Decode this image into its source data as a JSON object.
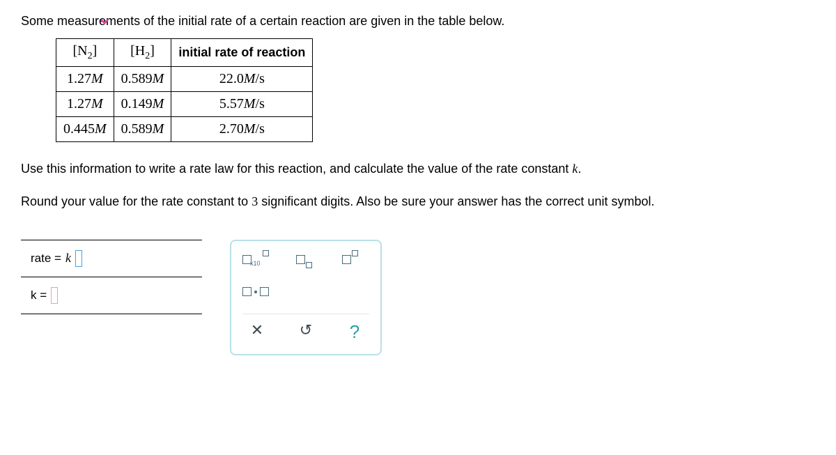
{
  "intro": "Some measurements of the initial rate of a certain reaction are given in the table below.",
  "table": {
    "headers": {
      "n2": "N",
      "n2sub": "2",
      "h2": "H",
      "h2sub": "2",
      "rate": "initial rate of reaction"
    },
    "rows": [
      {
        "n2": "1.27",
        "h2": "0.589",
        "rate": "22.0",
        "unit_m": "M",
        "unit_rate": "M/s"
      },
      {
        "n2": "1.27",
        "h2": "0.149",
        "rate": "5.57",
        "unit_m": "M",
        "unit_rate": "M/s"
      },
      {
        "n2": "0.445",
        "h2": "0.589",
        "rate": "2.70",
        "unit_m": "M",
        "unit_rate": "M/s"
      }
    ]
  },
  "instruction1_a": "Use this information to write a rate law for this reaction, and calculate the value of the rate constant ",
  "instruction1_k": "k",
  "instruction1_b": ".",
  "instruction2_a": "Round your value for the rate constant to ",
  "instruction2_n": "3",
  "instruction2_b": " significant digits. Also be sure your answer has the correct unit symbol.",
  "answer": {
    "rate_label": "rate =",
    "k_symbol": "k",
    "k_label": "k ="
  },
  "tools": {
    "x10": "x10",
    "clear": "✕",
    "reset": "↺",
    "help": "?"
  }
}
